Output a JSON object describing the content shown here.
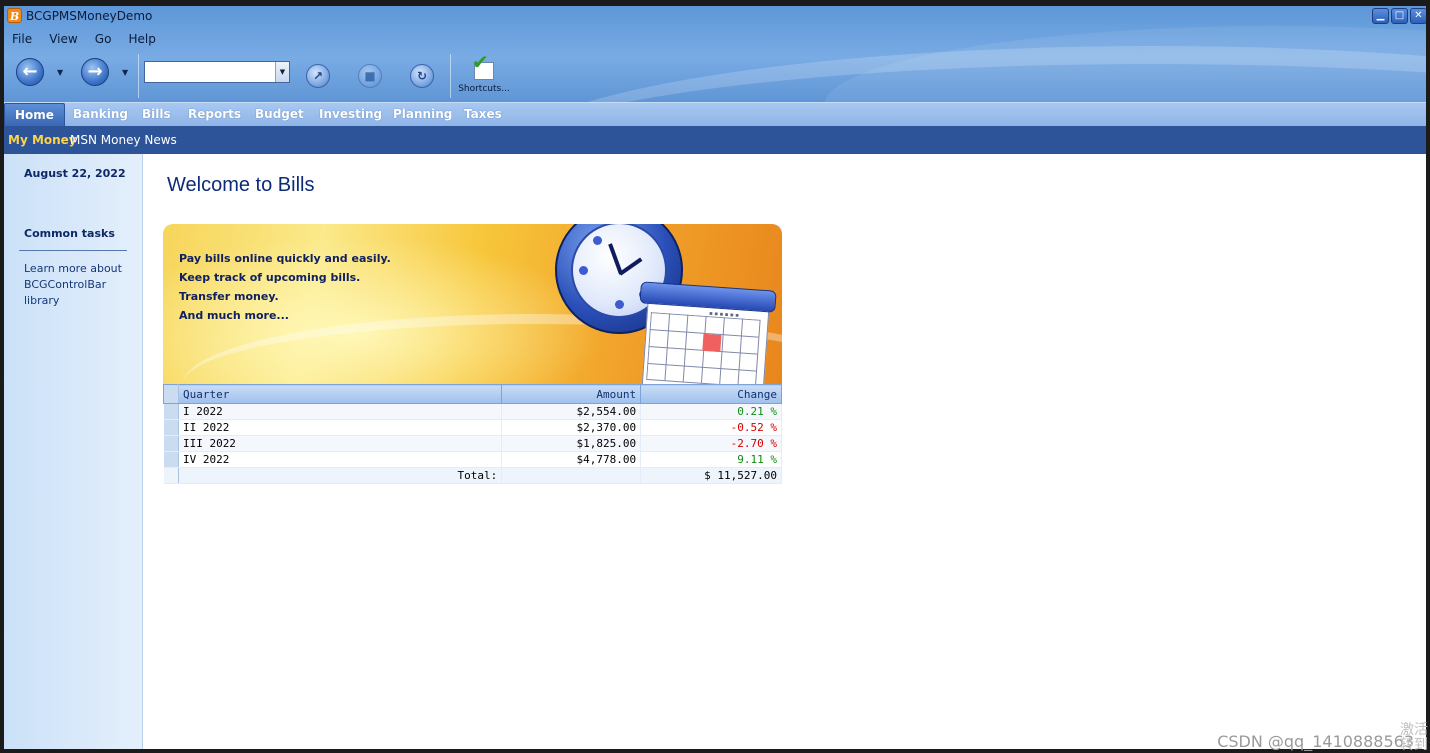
{
  "window": {
    "title": "BCGPMSMoneyDemo",
    "icon_letter": "B"
  },
  "menu": [
    "File",
    "View",
    "Go",
    "Help"
  ],
  "toolbar": {
    "back_icon": "arrow-left-icon",
    "forward_icon": "arrow-right-icon",
    "address_value": "",
    "refresh_glyph": "↻",
    "shortcuts_label": "Shortcuts..."
  },
  "tabs": [
    "Home",
    "Banking",
    "Bills",
    "Reports",
    "Budget",
    "Investing",
    "Planning",
    "Taxes"
  ],
  "active_tab": "Home",
  "subnav": {
    "my_money": "My Money",
    "msn": "MSN Money News"
  },
  "sidebar": {
    "date": "August 22, 2022",
    "tasks_title": "Common tasks",
    "task_link": "Learn more about BCGControlBar library"
  },
  "main": {
    "title": "Welcome to Bills",
    "banner_lines": [
      "Pay bills online quickly and easily.",
      "Keep track of upcoming bills.",
      "Transfer money.",
      "And much more..."
    ]
  },
  "table": {
    "headers": {
      "quarter": "Quarter",
      "amount": "Amount",
      "change": "Change"
    },
    "rows": [
      {
        "quarter": "I 2022",
        "amount": "$2,554.00",
        "change": "0.21 %",
        "trend": "pos"
      },
      {
        "quarter": "II 2022",
        "amount": "$2,370.00",
        "change": "-0.52 %",
        "trend": "neg"
      },
      {
        "quarter": "III 2022",
        "amount": "$1,825.00",
        "change": "-2.70 %",
        "trend": "neg"
      },
      {
        "quarter": "IV 2022",
        "amount": "$4,778.00",
        "change": "9.11 %",
        "trend": "pos"
      }
    ],
    "total_label": "Total:",
    "total_value": "$ 11,527.00"
  },
  "overlay": {
    "watermark": "CSDN @qq_1410888563",
    "activate": "激活\n转到"
  },
  "colors": {
    "positive": "#138a13",
    "negative": "#d40000",
    "accent": "#2d5398",
    "highlight": "#ffd24a"
  }
}
